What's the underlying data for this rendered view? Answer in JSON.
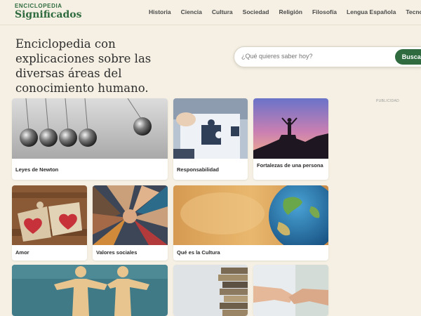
{
  "logo": {
    "top": "ENCICLOPEDIA",
    "main": "Significados"
  },
  "nav": [
    "Historia",
    "Ciencia",
    "Cultura",
    "Sociedad",
    "Religión",
    "Filosofía",
    "Lengua Española",
    "Tecnol"
  ],
  "hero": {
    "title": "Enciclopedia con explicaciones sobre las diversas áreas del conocimiento humano."
  },
  "search": {
    "placeholder": "¿Qué quieres saber hoy?",
    "button": "Buscar"
  },
  "ad_label": "PUBLICIDAD",
  "cards": [
    {
      "label": "Leyes de Newton"
    },
    {
      "label": "Responsabilidad"
    },
    {
      "label": "Fortalezas de una persona"
    },
    {
      "label": "Amor"
    },
    {
      "label": "Valores sociales"
    },
    {
      "label": "Qué es la Cultura"
    },
    {
      "label": ""
    },
    {
      "label": ""
    },
    {
      "label": ""
    }
  ]
}
